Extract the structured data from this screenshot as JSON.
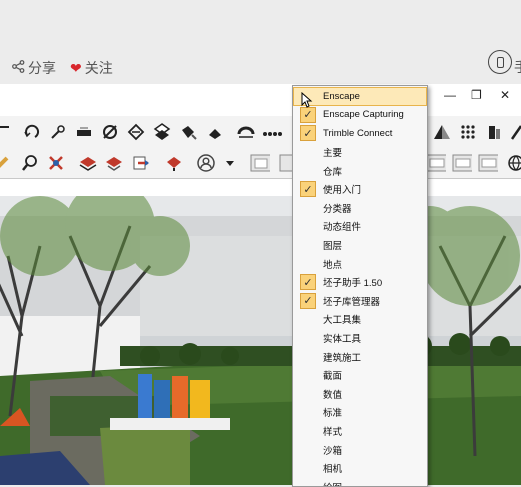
{
  "page": {
    "share_label": "分享",
    "follow_label": "关注",
    "cut_char": "手"
  },
  "window_controls": [
    "—",
    "❐",
    "✕"
  ],
  "menu": {
    "items": [
      {
        "label": "Enscape",
        "checked": false,
        "highlighted": true
      },
      {
        "label": "Enscape Capturing",
        "checked": true
      },
      {
        "label": "Trimble Connect",
        "checked": true
      },
      {
        "label": "主要",
        "checked": false
      },
      {
        "label": "仓库",
        "checked": false
      },
      {
        "label": "使用入门",
        "checked": true
      },
      {
        "label": "分类器",
        "checked": false
      },
      {
        "label": "动态组件",
        "checked": false
      },
      {
        "label": "图层",
        "checked": false
      },
      {
        "label": "地点",
        "checked": false
      },
      {
        "label": "坯子助手 1.50",
        "checked": true
      },
      {
        "label": "坯子库管理器",
        "checked": true
      },
      {
        "label": "大工具集",
        "checked": false
      },
      {
        "label": "实体工具",
        "checked": false
      },
      {
        "label": "建筑施工",
        "checked": false
      },
      {
        "label": "截面",
        "checked": false
      },
      {
        "label": "数值",
        "checked": false
      },
      {
        "label": "标准",
        "checked": false
      },
      {
        "label": "样式",
        "checked": false
      },
      {
        "label": "沙箱",
        "checked": false
      },
      {
        "label": "相机",
        "checked": false
      },
      {
        "label": "绘图",
        "checked": false
      }
    ]
  },
  "colors": {
    "accent_check": "#fad27a",
    "highlight": "#fde9b8",
    "heart": "#d8262c"
  }
}
